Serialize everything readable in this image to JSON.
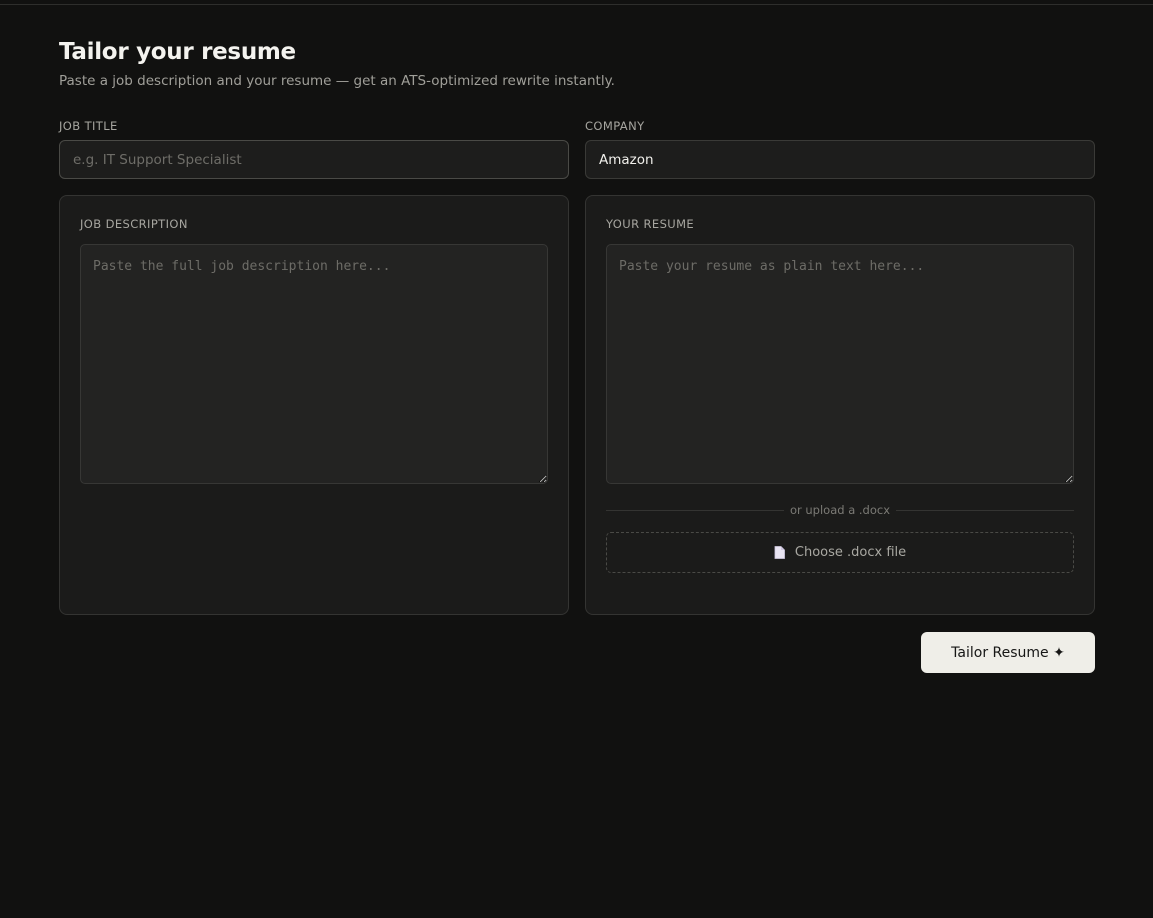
{
  "header": {
    "title": "Tailor your resume",
    "subtitle": "Paste a job description and your resume — get an ATS-optimized rewrite instantly."
  },
  "job_title": {
    "label": "JOB TITLE",
    "value": "",
    "placeholder": "e.g. IT Support Specialist"
  },
  "company": {
    "label": "COMPANY",
    "value": "Amazon",
    "placeholder": ""
  },
  "job_description": {
    "label": "JOB DESCRIPTION",
    "value": "",
    "placeholder": "Paste the full job description here..."
  },
  "resume": {
    "label": "YOUR RESUME",
    "value": "",
    "placeholder": "Paste your resume as plain text here...",
    "divider_text": "or upload a .docx",
    "upload_label": "Choose .docx file",
    "upload_icon": "document-icon"
  },
  "actions": {
    "submit_label": "Tailor Resume ✦"
  },
  "colors": {
    "background": "#111110",
    "panel": "#1b1b1a",
    "button": "#efeee8"
  }
}
